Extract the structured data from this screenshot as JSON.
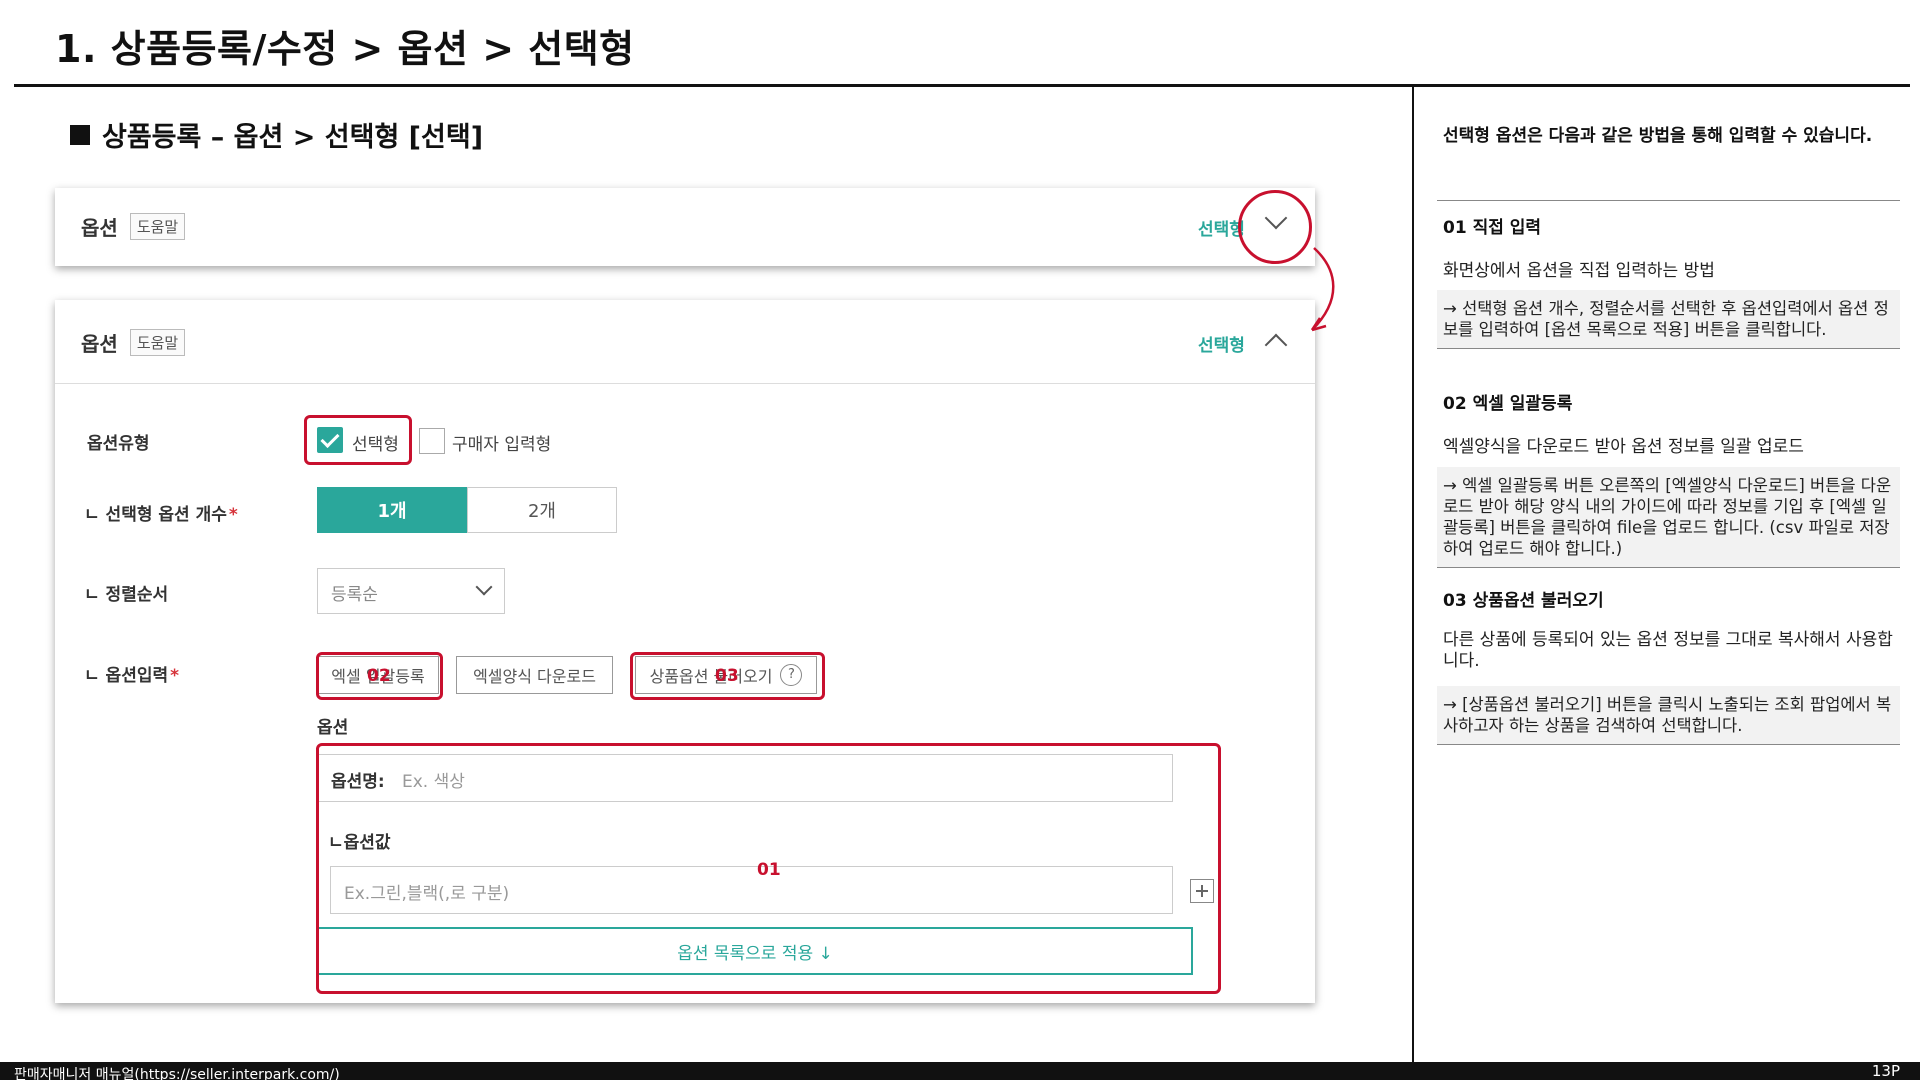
{
  "page": {
    "title": "1. 상품등록/수정 > 옵션 > 선택형",
    "section_title": "상품등록 – 옵션 > 선택형 [선택]"
  },
  "card_collapsed": {
    "title": "옵션",
    "help": "도움말",
    "type": "선택형"
  },
  "card_expanded": {
    "title": "옵션",
    "help": "도움말",
    "type": "선택형",
    "option_type_label": "옵션유형",
    "option_type_choices": [
      "선택형",
      "구매자 입력형"
    ],
    "option_type_selected": "선택형",
    "count_label": "ㄴ 선택형 옵션 개수",
    "count_choices": [
      "1개",
      "2개"
    ],
    "count_selected": "1개",
    "sort_label": "ㄴ 정렬순서",
    "sort_value": "등록순",
    "input_label": "ㄴ 옵션입력",
    "required_mark": "*",
    "excel_upload_button": "엑셀 일괄등록",
    "excel_template_button": "엑셀양식 다운로드",
    "load_option_button": "상품옵션 불러오기",
    "help_icon_text": "?",
    "options_heading": "옵션",
    "option_name_label": "옵션명:",
    "option_name_placeholder": "Ex. 색상",
    "option_value_label": "ㄴ옵션값",
    "option_value_placeholder": "Ex.그린,블랙(,로 구분)",
    "apply_button": "옵션 목록으로 적용 ↓"
  },
  "annotations": {
    "num_01": "01",
    "num_02": "02",
    "num_03": "03",
    "color": "#c8102e"
  },
  "notes": {
    "intro": "선택형 옵션은 다음과 같은 방법을 통해 입력할 수 있습니다.",
    "items": [
      {
        "heading": "01 직접 입력",
        "summary": "화면상에서 옵션을 직접 입력하는 방법",
        "detail": "→ 선택형 옵션 개수, 정렬순서를 선택한 후 옵션입력에서 옵션 정보를 입력하여 [옵션 목록으로 적용] 버튼을 클릭합니다."
      },
      {
        "heading": "02 엑셀 일괄등록",
        "summary": "엑셀양식을 다운로드 받아 옵션 정보를 일괄 업로드",
        "detail": "→ 엑셀 일괄등록 버튼 오른쪽의 [엑셀양식 다운로드] 버튼을 다운로드 받아 해당 양식 내의 가이드에 따라 정보를 기입 후 [엑셀 일괄등록] 버튼을 클릭하여 file을 업로드 합니다. (csv 파일로 저장하여 업로드 해야 합니다.)"
      },
      {
        "heading": "03 상품옵션 불러오기",
        "summary": "다른 상품에 등록되어 있는 옵션 정보를 그대로 복사해서 사용합니다.",
        "detail": "→ [상품옵션 불러오기] 버튼을 클릭시 노출되는 조회 팝업에서 복사하고자 하는 상품을 검색하여 선택합니다."
      }
    ]
  },
  "footer": {
    "left": "판매자매니저 매뉴얼(https://seller.interpark.com/)",
    "page_number": "13P"
  },
  "colors": {
    "accent": "#2aa79b",
    "annotation_red": "#c8102e"
  }
}
